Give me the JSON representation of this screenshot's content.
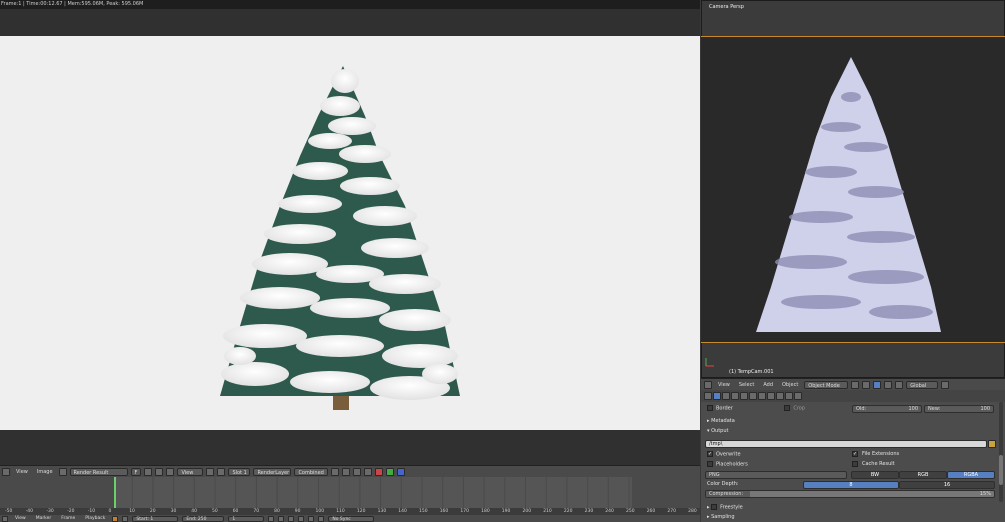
{
  "render": {
    "status_bar": "Frame:1 | Time:00:12.67 | Mem:595.06M, Peak: 595.06M"
  },
  "image_editor_header": {
    "view_menu": "View",
    "image_menu": "Image",
    "image_name": "Render Result",
    "f_label": "F",
    "view_label": "View",
    "slot": "Slot 1",
    "layer": "RenderLayer",
    "pass": "Combined"
  },
  "timeline": {
    "ticks": [
      "-50",
      "-40",
      "-30",
      "-20",
      "-10",
      "0",
      "10",
      "20",
      "30",
      "40",
      "50",
      "60",
      "70",
      "80",
      "90",
      "100",
      "110",
      "120",
      "130",
      "140",
      "150",
      "160",
      "170",
      "180",
      "190",
      "200",
      "210",
      "220",
      "230",
      "240",
      "250",
      "260",
      "270",
      "280"
    ],
    "footer": {
      "view": "View",
      "marker": "Marker",
      "frame": "Frame",
      "playback": "Playback",
      "start": "Start:",
      "start_val": "1",
      "end": "End:",
      "end_val": "250",
      "current": "1",
      "sync": "No Sync"
    }
  },
  "viewport": {
    "label": "Camera Persp",
    "object_label": "(1) TempCam.001"
  },
  "viewport_header": {
    "view": "View",
    "select": "Select",
    "add": "Add",
    "object": "Object",
    "mode": "Object Mode",
    "orientation": "Global"
  },
  "properties": {
    "border_label": "Border",
    "crop_label": "Crop",
    "old_label": "Old:",
    "old_val": "100",
    "new_label": "New:",
    "new_val": "100",
    "metadata_label": "Metadata",
    "output_label": "Output",
    "output_path": "/tmp\\",
    "overwrite_label": "Overwrite",
    "file_extensions_label": "File Extensions",
    "placeholders_label": "Placeholders",
    "cache_result_label": "Cache Result",
    "format": "PNG",
    "bw": "BW",
    "rgb": "RGB",
    "rgba": "RGBA",
    "color_depth_label": "Color Depth:",
    "depth_8": "8",
    "depth_16": "16",
    "compression_label": "Compression:",
    "compression_val": "15%",
    "compression_fraction": 0.15,
    "freestyle_label": "Freestyle",
    "sampling_label": "Sampling"
  },
  "colors": {
    "accent_blue": "#5680c2",
    "camera_frame": "#c9892b",
    "frame_cursor": "#6ad16a"
  }
}
